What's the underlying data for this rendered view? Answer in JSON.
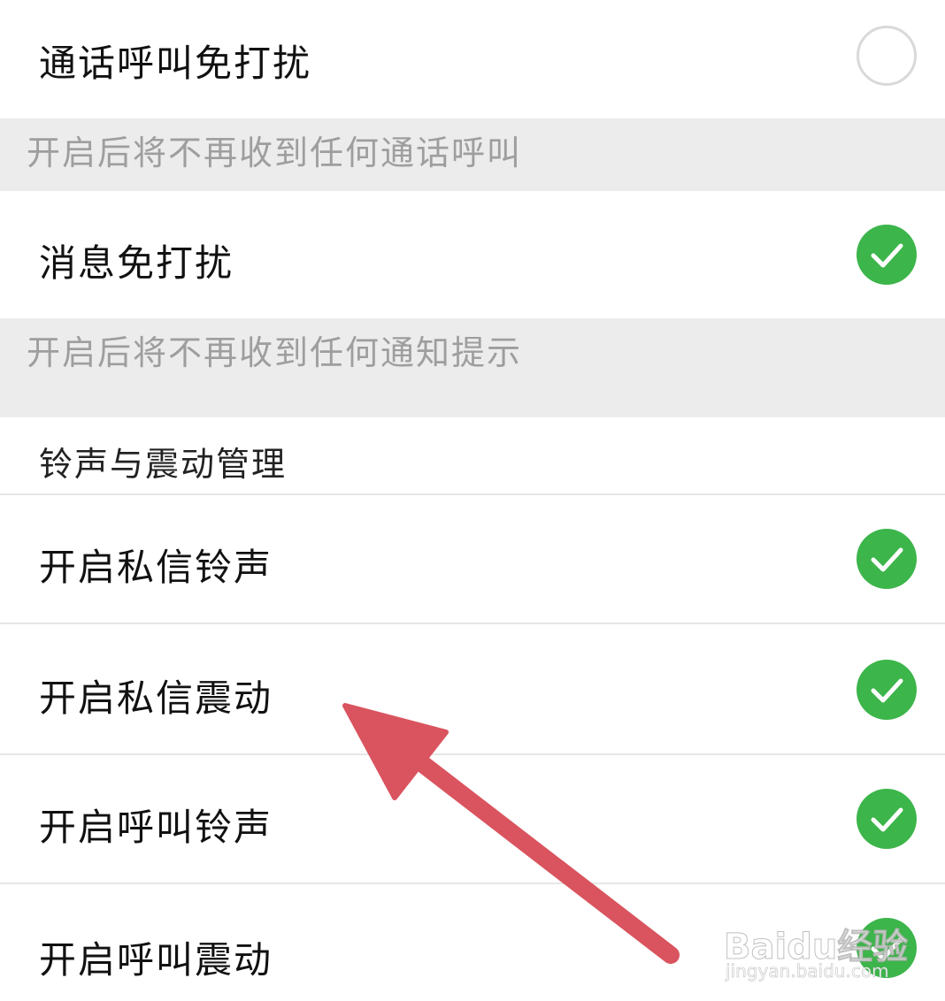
{
  "settings": {
    "call_dnd": {
      "label": "通话呼叫免打扰",
      "enabled": false,
      "hint": "开启后将不再收到任何通话呼叫"
    },
    "message_dnd": {
      "label": "消息免打扰",
      "enabled": true,
      "hint": "开启后将不再收到任何通知提示"
    },
    "ring_vibrate_section": {
      "title": "铃声与震动管理"
    },
    "items": [
      {
        "label": "开启私信铃声",
        "enabled": true
      },
      {
        "label": "开启私信震动",
        "enabled": true
      },
      {
        "label": "开启呼叫铃声",
        "enabled": true
      },
      {
        "label": "开启呼叫震动",
        "enabled": true
      }
    ]
  },
  "colors": {
    "toggle_on": "#3cb54a",
    "annotation_arrow": "#d9545e"
  },
  "icons": {
    "toggle_on": "checkmark-circle-icon",
    "toggle_off": "empty-circle-icon",
    "annotation": "red-arrow-icon"
  },
  "watermark": {
    "logo": "Baidu经验",
    "url": "jingyan.baidu.com"
  }
}
